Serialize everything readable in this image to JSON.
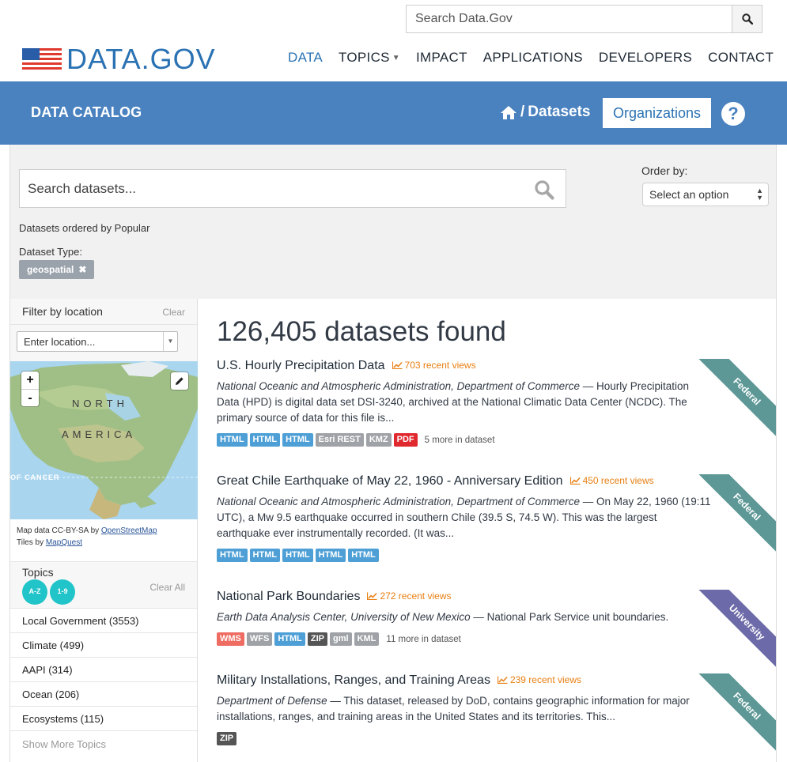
{
  "header": {
    "site_search_placeholder": "Search Data.Gov",
    "logo_text": "DATA.GOV",
    "nav": [
      "DATA",
      "TOPICS",
      "IMPACT",
      "APPLICATIONS",
      "DEVELOPERS",
      "CONTACT"
    ],
    "active_nav": "DATA"
  },
  "band": {
    "title": "DATA CATALOG",
    "crumb_sep": "/",
    "crumb": "Datasets",
    "orgs_button": "Organizations",
    "help": "?"
  },
  "search": {
    "placeholder": "Search datasets...",
    "order_label": "Order by:",
    "order_value": "Select an option",
    "ordered_by_text": "Datasets ordered by Popular",
    "dataset_type_label": "Dataset Type:",
    "filter_pill": "geospatial"
  },
  "sidebar": {
    "location_title": "Filter by location",
    "location_clear": "Clear",
    "location_placeholder": "Enter location...",
    "map_labels": [
      "NORTH",
      "AMERICA",
      "OF CANCER"
    ],
    "map_data_text": "Map data CC-BY-SA by ",
    "map_data_link": "OpenStreetMap",
    "tiles_text": "Tiles by ",
    "tiles_link": "MapQuest",
    "topics_title": "Topics",
    "topics_az": "A-Z",
    "topics_19": "1-9",
    "topics_clear": "Clear All",
    "topics": [
      "Local Government (3553)",
      "Climate (499)",
      "AAPI (314)",
      "Ocean (206)",
      "Ecosystems (115)"
    ],
    "show_more": "Show More Topics"
  },
  "results": {
    "count": "126,405 datasets found",
    "items": [
      {
        "title": "U.S. Hourly Precipitation Data",
        "views": "703 recent views",
        "org": "National Oceanic and Atmospheric Administration, Department of Commerce",
        "desc": " — Hourly Precipitation Data (HPD) is digital data set DSI-3240, archived at the National Climatic Data Center (NCDC). The primary source of data for this file is...",
        "more": "5 more in dataset",
        "ribbon": "Federal"
      },
      {
        "title": "Great Chile Earthquake of May 22, 1960 - Anniversary Edition",
        "views": "450 recent views",
        "org": "National Oceanic and Atmospheric Administration, Department of Commerce",
        "desc": " — On May 22, 1960 (19:11 UTC), a Mw 9.5 earthquake occurred in southern Chile (39.5 S, 74.5 W). This was the largest earthquake ever instrumentally recorded. (It was...",
        "more": "",
        "ribbon": "Federal"
      },
      {
        "title": "National Park Boundaries",
        "views": "272 recent views",
        "org": "Earth Data Analysis Center, University of New Mexico",
        "desc": " — National Park Service unit boundaries.",
        "more": "11 more in dataset",
        "ribbon": "University"
      },
      {
        "title": "Military Installations, Ranges, and Training Areas",
        "views": "239 recent views",
        "org": "Department of Defense",
        "desc": " — This dataset, released by DoD, contains geographic information for major installations, ranges, and training areas in the United States and its territories. This...",
        "more": "",
        "ribbon": "Federal"
      }
    ],
    "formats": [
      [
        [
          "HTML",
          "blue"
        ],
        [
          "HTML",
          "blue"
        ],
        [
          "HTML",
          "blue"
        ],
        [
          "Esri REST",
          "gray"
        ],
        [
          "KMZ",
          "gray"
        ],
        [
          "PDF",
          "red"
        ]
      ],
      [
        [
          "HTML",
          "blue"
        ],
        [
          "HTML",
          "blue"
        ],
        [
          "HTML",
          "blue"
        ],
        [
          "HTML",
          "blue"
        ],
        [
          "HTML",
          "blue"
        ]
      ],
      [
        [
          "WMS",
          "salmon"
        ],
        [
          "WFS",
          "gray"
        ],
        [
          "HTML",
          "blue"
        ],
        [
          "ZIP",
          "dark"
        ],
        [
          "gml",
          "gray"
        ],
        [
          "KML",
          "gray"
        ]
      ],
      [
        [
          "ZIP",
          "dark"
        ]
      ]
    ]
  },
  "colors": {
    "brand_blue": "#4a82c0",
    "link_blue": "#2a72b3",
    "views_orange": "#e87f12",
    "federal_ribbon": "#5d9896",
    "university_ribbon": "#6c6aa8"
  }
}
